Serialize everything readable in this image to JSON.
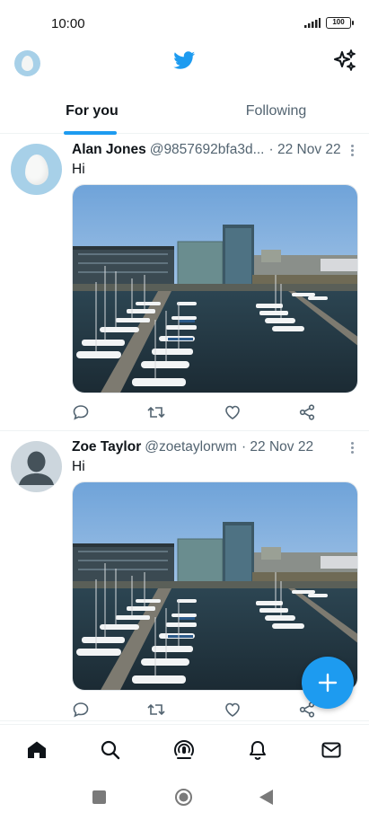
{
  "status_bar": {
    "time": "10:00",
    "battery": "100",
    "icons": [
      "signal-icon",
      "battery-icon"
    ]
  },
  "header": {
    "logo": "twitter-bird-icon",
    "left_icon": "profile-avatar",
    "right_icon": "sparkle-icon",
    "accent_color": "#1d9bf0"
  },
  "tabs": [
    {
      "label": "For you",
      "active": true
    },
    {
      "label": "Following",
      "active": false
    }
  ],
  "tweets": [
    {
      "name": "Alan Jones",
      "handle": "@9857692bfa3d...",
      "date": "· 22 Nov 22",
      "text": "Hi",
      "avatar": "egg-avatar",
      "media": "harbor-photo"
    },
    {
      "name": "Zoe Taylor",
      "handle": "@zoetaylorwm",
      "date": "· 22 Nov 22",
      "text": "Hi",
      "avatar": "default-person-avatar",
      "media": "harbor-photo"
    }
  ],
  "actions": [
    "reply-icon",
    "retweet-icon",
    "like-icon",
    "share-icon"
  ],
  "fab": {
    "icon": "plus-icon"
  },
  "bottom_nav": [
    "home-icon",
    "search-icon",
    "spaces-icon",
    "notifications-icon",
    "messages-icon"
  ],
  "system_nav": [
    "recents-button",
    "home-button",
    "back-button"
  ]
}
